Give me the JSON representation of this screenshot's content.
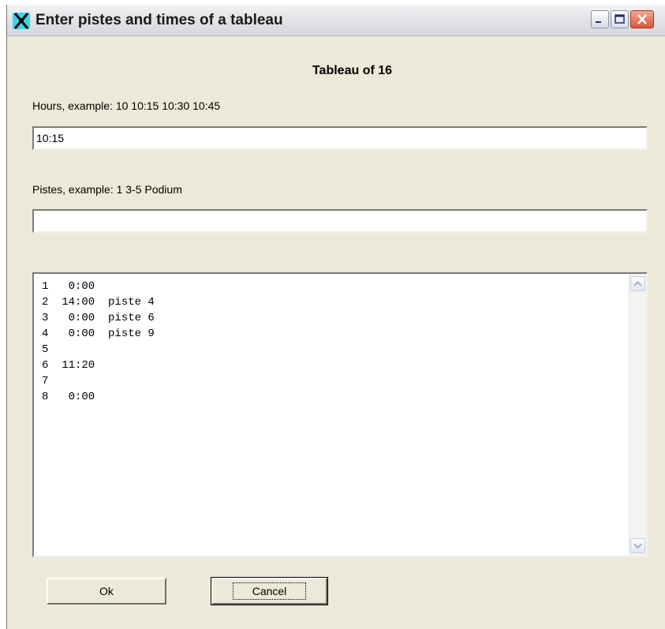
{
  "window": {
    "title": "Enter pistes and times of a tableau",
    "icon": "fencing-app-icon",
    "controls": [
      "minimize-icon",
      "maximize-icon",
      "close-icon"
    ]
  },
  "heading": "Tableau of 16",
  "hours": {
    "label": "Hours, example: 10 10:15 10:30 10:45",
    "value": "10:15"
  },
  "pistes": {
    "label": "Pistes, example: 1 3-5  Podium",
    "value": ""
  },
  "list": {
    "rows": [
      "1   0:00",
      "2  14:00  piste 4",
      "3   0:00  piste 6",
      "4   0:00  piste 9",
      "5",
      "6  11:20",
      "7",
      "8   0:00"
    ]
  },
  "buttons": {
    "ok": "Ok",
    "cancel": "Cancel"
  }
}
